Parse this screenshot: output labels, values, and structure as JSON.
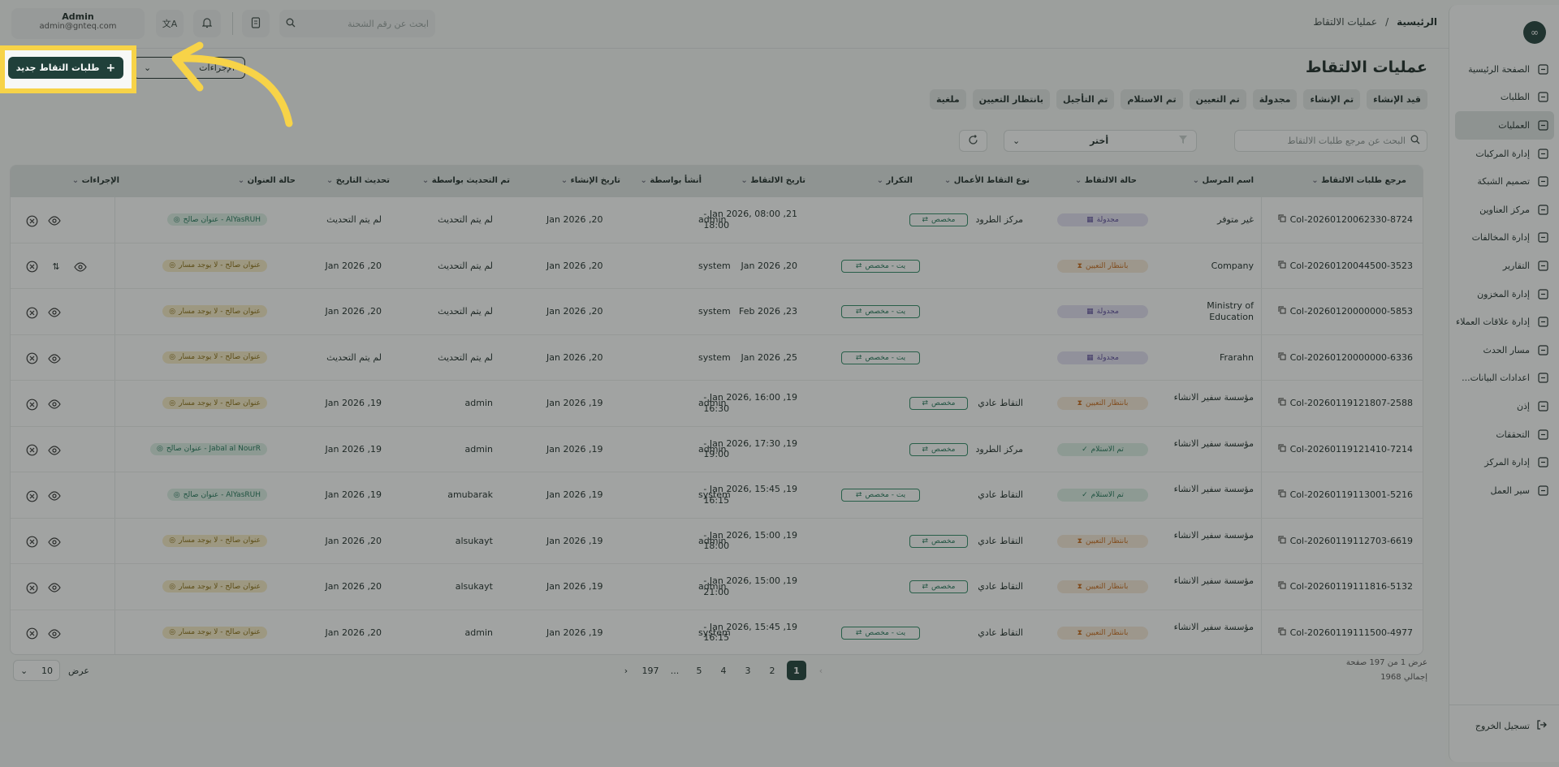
{
  "header": {
    "breadcrumb_home": "الرئيسية",
    "breadcrumb_sep": "/",
    "breadcrumb_current": "عمليات الالتقاط",
    "search_placeholder": "ابحث عن رقم الشحنة",
    "user_name": "Admin",
    "user_email": "admin@gnteq.com"
  },
  "page": {
    "title": "عمليات الالتقاط",
    "new_button": "طلبات التقاط جديد",
    "actions_button": "الإجراءات"
  },
  "tabs": [
    "قيد الإنشاء",
    "تم الإنشاء",
    "مجدولة",
    "تم التعيين",
    "تم الاستلام",
    "تم التأجيل",
    "بانتظار التعيين",
    "ملغية"
  ],
  "filters": {
    "search_placeholder": "البحث عن مرجع طلبات الالتقاط",
    "select_value": "أختر"
  },
  "table": {
    "headers": [
      "مرجع طلبات الالتقاط",
      "اسم المرسل",
      "حالة الالتقاط",
      "نوع التقاط الأعمال",
      "التكرار",
      "تاريخ الالتقاط",
      "أنشأ بواسطة",
      "تاريخ الإنشاء",
      "تم التحديث بواسطة",
      "تحديث التاريخ",
      "حالة العنوان",
      "الإجراءات"
    ],
    "rows": [
      {
        "ref": "Col-20260120062330-8724",
        "sender": "غير متوفر",
        "status": "مجدولة",
        "status_kind": "purple",
        "type": "مركز الطرود",
        "repeat": "مخصص",
        "repeat_wide": false,
        "date1": "21, Jan 2026, 08:00 -",
        "date2": "18:00",
        "created_by": "admin",
        "created": "20, Jan 2026",
        "updated_by": "لم يتم التحديث",
        "updated": "لم يتم التحديث",
        "addr": "AlYasRUH - عنوان صالح",
        "addr_kind": "green",
        "icons": 2
      },
      {
        "ref": "Col-20260120044500-3523",
        "sender": "Company",
        "status": "بانتظار التعيين",
        "status_kind": "orange",
        "type": "",
        "repeat": "يت - مخصص",
        "repeat_wide": true,
        "date1": "20, Jan 2026",
        "date2": "",
        "created_by": "system",
        "created": "20, Jan 2026",
        "updated_by": "لم يتم التحديث",
        "updated": "20, Jan 2026",
        "addr": "عنوان صالح - لا يوجد مسار",
        "addr_kind": "yellow",
        "icons": 3
      },
      {
        "ref": "Col-20260120000000-5853",
        "sender": "Ministry of Education",
        "status": "مجدولة",
        "status_kind": "purple",
        "type": "",
        "repeat": "يت - مخصص",
        "repeat_wide": true,
        "date1": "23, Feb 2026",
        "date2": "",
        "created_by": "system",
        "created": "20, Jan 2026",
        "updated_by": "لم يتم التحديث",
        "updated": "20, Jan 2026",
        "addr": "عنوان صالح - لا يوجد مسار",
        "addr_kind": "yellow",
        "icons": 2
      },
      {
        "ref": "Col-20260120000000-6336",
        "sender": "Frarahn",
        "status": "مجدولة",
        "status_kind": "purple",
        "type": "",
        "repeat": "يت - مخصص",
        "repeat_wide": true,
        "date1": "25, Jan 2026",
        "date2": "",
        "created_by": "system",
        "created": "20, Jan 2026",
        "updated_by": "لم يتم التحديث",
        "updated": "لم يتم التحديث",
        "addr": "عنوان صالح - لا يوجد مسار",
        "addr_kind": "yellow",
        "icons": 2
      },
      {
        "ref": "Col-20260119121807-2588",
        "sender": "مؤسسة سفير الانشاء",
        "status": "بانتظار التعيين",
        "status_kind": "orange",
        "type": "التقاط عادي",
        "repeat": "مخصص",
        "repeat_wide": false,
        "date1": "19, Jan 2026, 16:00 -",
        "date2": "16:30",
        "created_by": "admin",
        "created": "19, Jan 2026",
        "updated_by": "admin",
        "updated": "19, Jan 2026",
        "addr": "عنوان صالح - لا يوجد مسار",
        "addr_kind": "yellow",
        "icons": 2
      },
      {
        "ref": "Col-20260119121410-7214",
        "sender": "مؤسسة سفير الانشاء",
        "status": "تم الاستلام",
        "status_kind": "green",
        "type": "مركز الطرود",
        "repeat": "مخصص",
        "repeat_wide": false,
        "date1": "19, Jan 2026, 17:30 -",
        "date2": "19:00",
        "created_by": "admin",
        "created": "19, Jan 2026",
        "updated_by": "admin",
        "updated": "19, Jan 2026",
        "addr": "Jabal al NourR - عنوان صالح",
        "addr_kind": "green",
        "icons": 2
      },
      {
        "ref": "Col-20260119113001-5216",
        "sender": "مؤسسة سفير الانشاء",
        "status": "تم الاستلام",
        "status_kind": "green",
        "type": "التقاط عادي",
        "repeat": "يت - مخصص",
        "repeat_wide": true,
        "date1": "19, Jan 2026, 15:45 -",
        "date2": "16:15",
        "created_by": "system",
        "created": "19, Jan 2026",
        "updated_by": "amubarak",
        "updated": "19, Jan 2026",
        "addr": "AlYasRUH - عنوان صالح",
        "addr_kind": "green",
        "icons": 2
      },
      {
        "ref": "Col-20260119112703-6619",
        "sender": "مؤسسة سفير الانشاء",
        "status": "بانتظار التعيين",
        "status_kind": "orange",
        "type": "التقاط عادي",
        "repeat": "مخصص",
        "repeat_wide": false,
        "date1": "19, Jan 2026, 15:00 -",
        "date2": "18:00",
        "created_by": "admin",
        "created": "19, Jan 2026",
        "updated_by": "alsukayt",
        "updated": "20, Jan 2026",
        "addr": "عنوان صالح - لا يوجد مسار",
        "addr_kind": "yellow",
        "icons": 2
      },
      {
        "ref": "Col-20260119111816-5132",
        "sender": "مؤسسة سفير الانشاء",
        "status": "بانتظار التعيين",
        "status_kind": "orange",
        "type": "التقاط عادي",
        "repeat": "مخصص",
        "repeat_wide": false,
        "date1": "19, Jan 2026, 15:00 -",
        "date2": "21:00",
        "created_by": "admin",
        "created": "19, Jan 2026",
        "updated_by": "alsukayt",
        "updated": "20, Jan 2026",
        "addr": "عنوان صالح - لا يوجد مسار",
        "addr_kind": "yellow",
        "icons": 2
      },
      {
        "ref": "Col-20260119111500-4977",
        "sender": "مؤسسة سفير الانشاء",
        "status": "بانتظار التعيين",
        "status_kind": "orange",
        "type": "التقاط عادي",
        "repeat": "يت - مخصص",
        "repeat_wide": true,
        "date1": "19, Jan 2026, 15:45 -",
        "date2": "16:15",
        "created_by": "system",
        "created": "19, Jan 2026",
        "updated_by": "admin",
        "updated": "20, Jan 2026",
        "addr": "عنوان صالح - لا يوجد مسار",
        "addr_kind": "yellow",
        "icons": 2
      }
    ]
  },
  "pagination": {
    "pages": [
      "1",
      "2",
      "3",
      "4",
      "5",
      "...",
      "197"
    ],
    "current": "1",
    "info_line1": "عرض 1 من 197 صفحة",
    "info_line2": "إجمالي 1968",
    "show_label": "عرض",
    "page_size": "10"
  },
  "sidebar": {
    "items": [
      {
        "label": "الصفحة الرئيسية",
        "icon": "dashboard-icon"
      },
      {
        "label": "الطلبات",
        "icon": "orders-icon"
      },
      {
        "label": "العمليات",
        "icon": "operations-icon",
        "active": true
      },
      {
        "label": "إدارة المركبات",
        "icon": "truck-icon"
      },
      {
        "label": "تصميم الشبكة",
        "icon": "network-icon"
      },
      {
        "label": "مركز العناوين",
        "icon": "address-icon"
      },
      {
        "label": "إدارة المخالفات",
        "icon": "violation-icon"
      },
      {
        "label": "التقارير",
        "icon": "report-icon"
      },
      {
        "label": "إدارة المخزون",
        "icon": "inventory-icon"
      },
      {
        "label": "إدارة علاقات العملاء",
        "icon": "crm-icon"
      },
      {
        "label": "مسار الحدث",
        "icon": "route-icon"
      },
      {
        "label": "اعدادات البيانات...",
        "icon": "database-icon"
      },
      {
        "label": "إذن",
        "icon": "permission-icon"
      },
      {
        "label": "التحققات",
        "icon": "verification-icon"
      },
      {
        "label": "إدارة المركز",
        "icon": "hub-icon"
      },
      {
        "label": "سير العمل",
        "icon": "workflow-icon"
      }
    ],
    "logout": "تسجيل الخروج",
    "logo": "∞"
  },
  "colors": {
    "primary": "#20403a",
    "highlight": "#f7d348",
    "overlay": "rgba(30,35,34,0.42)"
  }
}
